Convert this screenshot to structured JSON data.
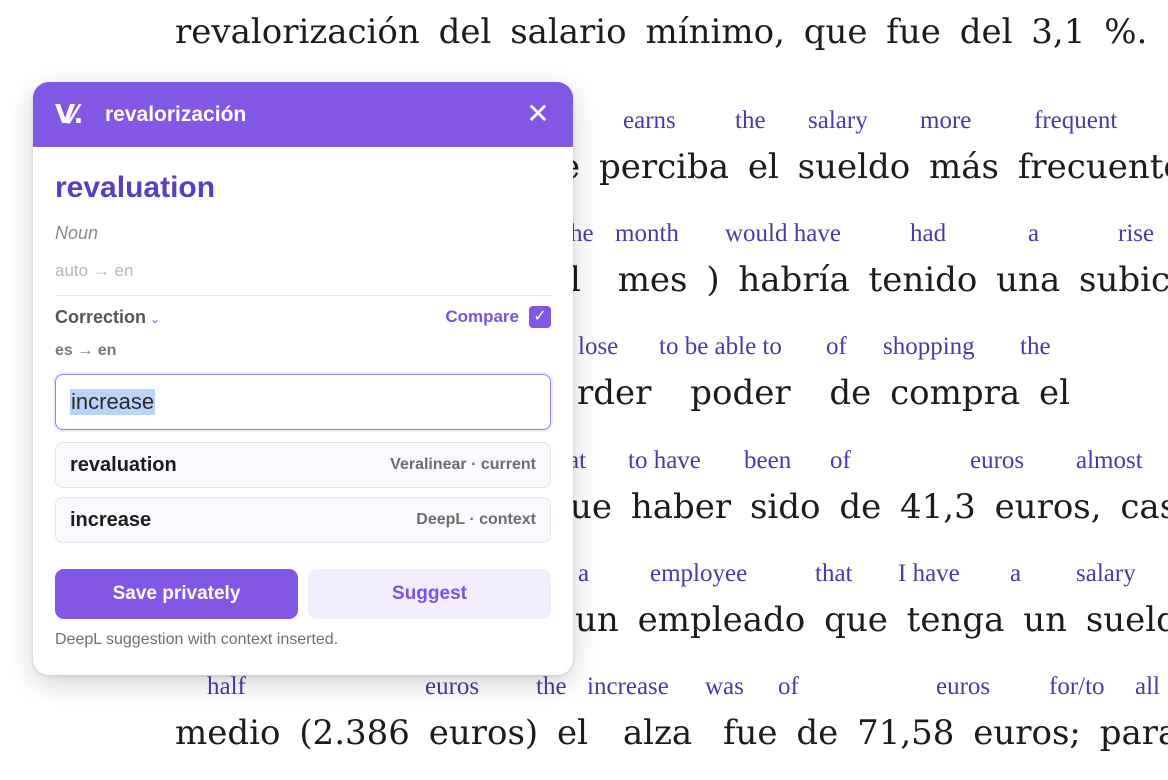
{
  "reader": {
    "line0": [
      "revalorización",
      "del",
      "salario",
      "mínimo,",
      "que",
      "fue",
      "del",
      "3,1",
      "%."
    ],
    "rows": [
      {
        "gloss": [
          "earns",
          "the",
          "salary",
          "more",
          "frequent"
        ],
        "source": [
          "e",
          "perciba",
          "el",
          "sueldo",
          "más",
          "frecuente"
        ]
      },
      {
        "gloss": [
          "he",
          "month",
          "would have",
          "had",
          "a",
          "rise"
        ],
        "source": [
          "l",
          "mes",
          ")",
          "habría",
          "tenido",
          "una",
          "subic"
        ]
      },
      {
        "gloss": [
          "lose",
          "to be able to",
          "of",
          "shopping",
          "the"
        ],
        "source": [
          "rder",
          "poder",
          "de",
          "compra",
          "el"
        ]
      },
      {
        "gloss": [
          "at",
          "to have",
          "been",
          "of",
          "euros",
          "almost"
        ],
        "source": [
          "ue",
          "haber",
          "sido",
          "de",
          "41,3",
          "euros,",
          "casi"
        ]
      },
      {
        "gloss": [
          "a",
          "employee",
          "that",
          "I have",
          "a",
          "salary"
        ],
        "source": [
          "un",
          "empleado",
          "que",
          "tenga",
          "un",
          "sueldo"
        ]
      },
      {
        "gloss": [
          "half",
          "euros",
          "the",
          "increase",
          "was",
          "of",
          "euros",
          "for/to",
          "all"
        ],
        "source": [
          "medio",
          "(2.386",
          "euros)",
          "el",
          "alza",
          "fue",
          "de",
          "71,58",
          "euros;",
          "para",
          "pa"
        ]
      }
    ]
  },
  "popup": {
    "logo": "V⁄.",
    "title": "revalorización",
    "close_glyph": "✕",
    "headword": "revaluation",
    "pos": "Noun",
    "langs": "auto → en",
    "correction_label": "Correction",
    "chevron": "⌄",
    "compare_label": "Compare",
    "check_glyph": "✓",
    "correction_langs": "es → en",
    "input_value": "increase",
    "options": [
      {
        "word": "revaluation",
        "source": "Veralinear · current"
      },
      {
        "word": "increase",
        "source": "DeepL · context"
      }
    ],
    "save_label": "Save privately",
    "suggest_label": "Suggest",
    "note": "DeepL suggestion with context inserted."
  },
  "colors": {
    "accent": "#8257e6",
    "gloss": "#4a3aa8",
    "headword": "#5a3dc0"
  }
}
